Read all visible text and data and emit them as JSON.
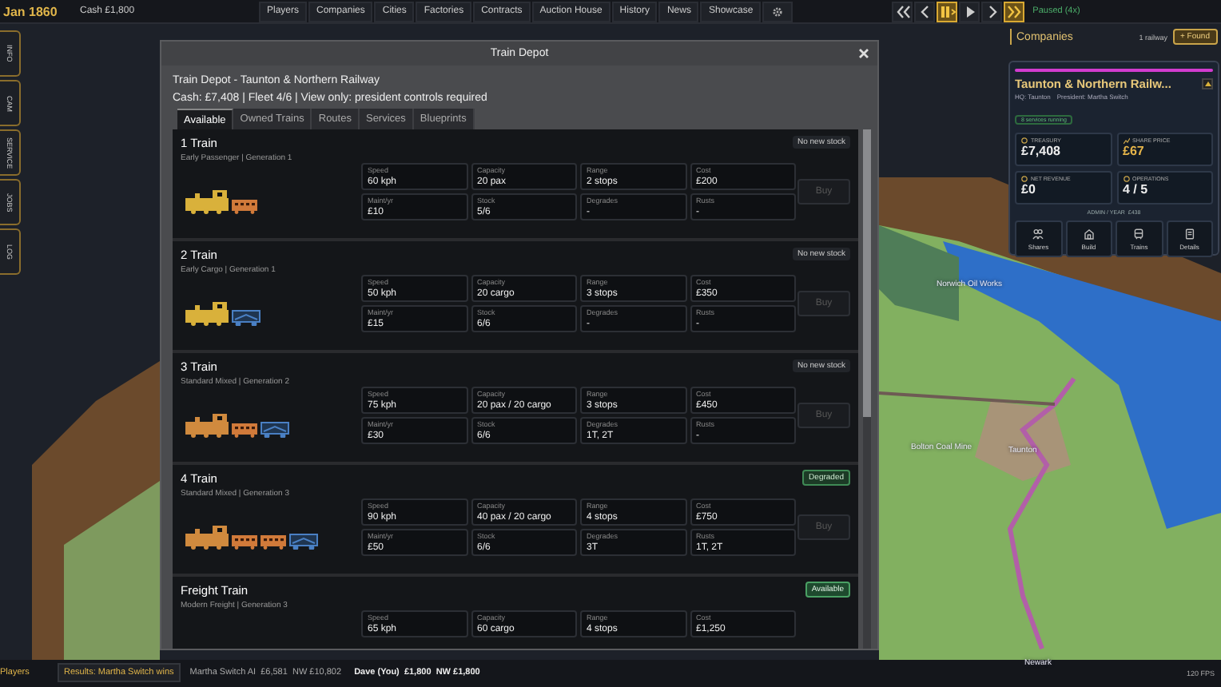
{
  "top_bar": {
    "date": "Jan 1860",
    "cash": "Cash £1,800",
    "nav": [
      "Players",
      "Companies",
      "Cities",
      "Factories",
      "Contracts",
      "Auction House",
      "History",
      "News",
      "Showcase"
    ],
    "speed_controls": [
      {
        "kind": "rewind",
        "on": false
      },
      {
        "kind": "back",
        "on": false
      },
      {
        "kind": "pause",
        "on": true
      },
      {
        "kind": "play",
        "on": false
      },
      {
        "kind": "forward",
        "on": false
      },
      {
        "kind": "fast",
        "on": true
      }
    ],
    "status": "Paused (4x)"
  },
  "side_tabs": [
    "INFO",
    "CAM",
    "SERVICE",
    "JOBS",
    "LOG"
  ],
  "map_labels": [
    "Norwich Oil Works",
    "Bolton Coal Mine",
    "Taunton",
    "Newark"
  ],
  "dialog": {
    "title": "Train Depot",
    "heading": "Train Depot - Taunton & Northern Railway",
    "summary": "Cash: £7,408 | Fleet 4/6 | View only: president controls required",
    "tabs": [
      {
        "label": "Available",
        "selected": true
      },
      {
        "label": "Owned Trains",
        "selected": false
      },
      {
        "label": "Routes",
        "selected": false
      },
      {
        "label": "Services",
        "selected": false
      },
      {
        "label": "Blueprints",
        "selected": false
      }
    ],
    "trains": [
      {
        "name": "1 Train",
        "subtitle": "Early Passenger | Generation 1",
        "status": {
          "text": "No new stock",
          "kind": "none"
        },
        "cars": [
          {
            "kind": "engine",
            "color": "#d9b13b"
          },
          {
            "kind": "coach",
            "color": "#d17a3a"
          }
        ],
        "stats": [
          {
            "label": "Speed",
            "value": "60 kph"
          },
          {
            "label": "Capacity",
            "value": "20 pax"
          },
          {
            "label": "Range",
            "value": "2 stops"
          },
          {
            "label": "Cost",
            "value": "£200"
          },
          {
            "label": "Maint/yr",
            "value": "£10"
          },
          {
            "label": "Stock",
            "value": "5/6"
          },
          {
            "label": "Degrades",
            "value": "-"
          },
          {
            "label": "Rusts",
            "value": "-"
          }
        ],
        "buy": "Buy"
      },
      {
        "name": "2 Train",
        "subtitle": "Early Cargo | Generation 1",
        "status": {
          "text": "No new stock",
          "kind": "none"
        },
        "cars": [
          {
            "kind": "engine",
            "color": "#d9b13b"
          },
          {
            "kind": "wagon",
            "color": "#4a80c4"
          }
        ],
        "stats": [
          {
            "label": "Speed",
            "value": "50 kph"
          },
          {
            "label": "Capacity",
            "value": "20 cargo"
          },
          {
            "label": "Range",
            "value": "3 stops"
          },
          {
            "label": "Cost",
            "value": "£350"
          },
          {
            "label": "Maint/yr",
            "value": "£15"
          },
          {
            "label": "Stock",
            "value": "6/6"
          },
          {
            "label": "Degrades",
            "value": "-"
          },
          {
            "label": "Rusts",
            "value": "-"
          }
        ],
        "buy": "Buy"
      },
      {
        "name": "3 Train",
        "subtitle": "Standard Mixed | Generation 2",
        "status": {
          "text": "No new stock",
          "kind": "none"
        },
        "cars": [
          {
            "kind": "engine",
            "color": "#d08a3e"
          },
          {
            "kind": "coach",
            "color": "#d17a3a"
          },
          {
            "kind": "wagon",
            "color": "#4a80c4"
          }
        ],
        "stats": [
          {
            "label": "Speed",
            "value": "75 kph"
          },
          {
            "label": "Capacity",
            "value": "20 pax / 20 cargo"
          },
          {
            "label": "Range",
            "value": "3 stops"
          },
          {
            "label": "Cost",
            "value": "£450"
          },
          {
            "label": "Maint/yr",
            "value": "£30"
          },
          {
            "label": "Stock",
            "value": "6/6"
          },
          {
            "label": "Degrades",
            "value": "1T, 2T"
          },
          {
            "label": "Rusts",
            "value": "-"
          }
        ],
        "buy": "Buy"
      },
      {
        "name": "4 Train",
        "subtitle": "Standard Mixed | Generation 3",
        "status": {
          "text": "Degraded",
          "kind": "degraded"
        },
        "cars": [
          {
            "kind": "engine",
            "color": "#d08a3e"
          },
          {
            "kind": "coach",
            "color": "#d17a3a"
          },
          {
            "kind": "coach",
            "color": "#d17a3a"
          },
          {
            "kind": "wagon",
            "color": "#4a80c4"
          }
        ],
        "stats": [
          {
            "label": "Speed",
            "value": "90 kph"
          },
          {
            "label": "Capacity",
            "value": "40 pax / 20 cargo"
          },
          {
            "label": "Range",
            "value": "4 stops"
          },
          {
            "label": "Cost",
            "value": "£750"
          },
          {
            "label": "Maint/yr",
            "value": "£50"
          },
          {
            "label": "Stock",
            "value": "6/6"
          },
          {
            "label": "Degrades",
            "value": "3T"
          },
          {
            "label": "Rusts",
            "value": "1T, 2T"
          }
        ],
        "buy": "Buy"
      },
      {
        "name": "Freight Train",
        "subtitle": "Modern Freight | Generation 3",
        "status": {
          "text": "Available",
          "kind": "available"
        },
        "stats": [
          {
            "label": "Speed",
            "value": "65 kph"
          },
          {
            "label": "Capacity",
            "value": "60 cargo"
          },
          {
            "label": "Range",
            "value": "4 stops"
          },
          {
            "label": "Cost",
            "value": "£1,250"
          }
        ]
      }
    ]
  },
  "companies": {
    "title": "Companies",
    "count": "1 railway",
    "found": "+ Found",
    "name": "Taunton & Northern Railw...",
    "hq": "HQ: Taunton",
    "president": "President: Martha Switch",
    "badge": "8 services running",
    "stats": [
      {
        "kind": "treasury",
        "label": "TREASURY",
        "value": "£7,408",
        "accent": false
      },
      {
        "kind": "price",
        "label": "SHARE PRICE",
        "value": "£67",
        "accent": true
      },
      {
        "kind": "revenue",
        "label": "NET REVENUE",
        "value": "£0",
        "accent": false
      },
      {
        "kind": "operations",
        "label": "OPERATIONS",
        "value": "4 / 5",
        "accent": false
      }
    ],
    "admin": "ADMIN / YEAR  £438",
    "actions": [
      {
        "kind": "shares",
        "label": "Shares"
      },
      {
        "kind": "build",
        "label": "Build"
      },
      {
        "kind": "trains",
        "label": "Trains"
      },
      {
        "kind": "details",
        "label": "Details"
      }
    ]
  },
  "bottom_bar": {
    "players": "Players",
    "result": "Results: Martha Switch wins",
    "entries": [
      {
        "name": "Martha Switch AI",
        "cash": "£6,581",
        "nw": "NW £10,802",
        "you": false
      },
      {
        "name": "Dave (You)",
        "cash": "£1,800",
        "nw": "NW £1,800",
        "you": true
      }
    ],
    "fps": "120 FPS"
  }
}
